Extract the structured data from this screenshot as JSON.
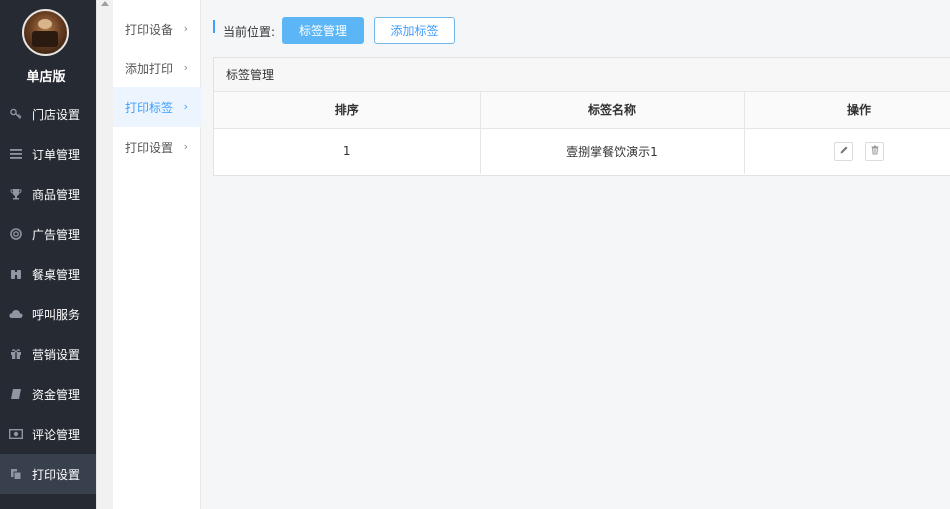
{
  "store": {
    "name": "单店版"
  },
  "nav": [
    {
      "label": "门店设置",
      "icon": "key-icon"
    },
    {
      "label": "订单管理",
      "icon": "list-icon"
    },
    {
      "label": "商品管理",
      "icon": "trophy-icon"
    },
    {
      "label": "广告管理",
      "icon": "lifebuoy-icon"
    },
    {
      "label": "餐桌管理",
      "icon": "binoculars-icon"
    },
    {
      "label": "呼叫服务",
      "icon": "cloud-icon"
    },
    {
      "label": "营销设置",
      "icon": "gift-icon"
    },
    {
      "label": "资金管理",
      "icon": "book-icon"
    },
    {
      "label": "评论管理",
      "icon": "money-icon"
    },
    {
      "label": "打印设置",
      "icon": "copy-icon"
    }
  ],
  "submenu": [
    {
      "label": "打印设备"
    },
    {
      "label": "添加打印"
    },
    {
      "label": "打印标签"
    },
    {
      "label": "打印设置"
    }
  ],
  "breadcrumb": {
    "label": "当前位置:",
    "current": "标签管理",
    "add_button": "添加标签"
  },
  "panel": {
    "title": "标签管理",
    "columns": [
      "排序",
      "标签名称",
      "操作"
    ],
    "rows": [
      {
        "sort": "1",
        "name": "壹捌掌餐饮演示1"
      }
    ]
  },
  "colors": {
    "accent": "#409eff",
    "sidebar": "#252a33",
    "primary_button": "#5cb6f5"
  }
}
